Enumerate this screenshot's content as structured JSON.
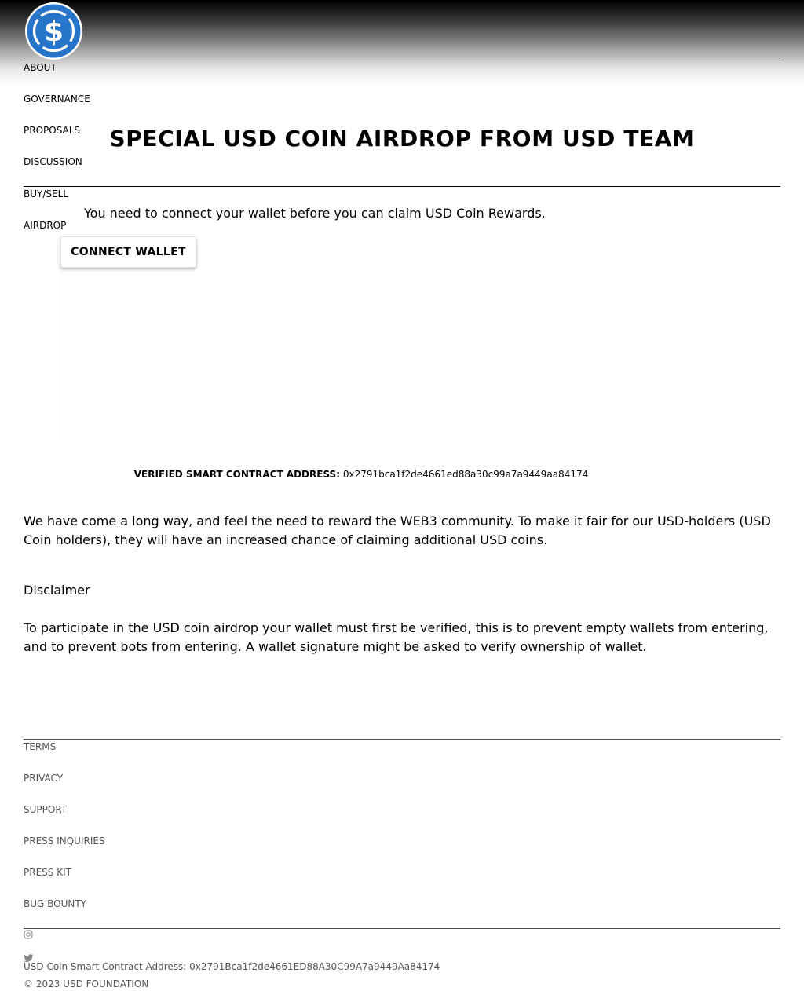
{
  "header": {
    "logo_icon": "usd-coin-logo",
    "brand_color": "#2775ca"
  },
  "nav": {
    "items": [
      {
        "label": "ABOUT"
      },
      {
        "label": "GOVERNANCE"
      },
      {
        "label": "PROPOSALS"
      },
      {
        "label": "DISCUSSION"
      },
      {
        "label": "BUY/SELL"
      },
      {
        "label": "AIRDROP"
      }
    ]
  },
  "main": {
    "title": "SPECIAL USD COIN AIRDROP FROM USD TEAM",
    "connect_message": "You need to connect your wallet before you can claim USD Coin Rewards.",
    "connect_button": "CONNECT WALLET",
    "contract_label": "VERIFIED SMART CONTRACT ADDRESS:",
    "contract_address": "0x2791bca1f2de4661ed88a30c99a7a9449aa84174",
    "intro": "We have come a long way, and feel the need to reward the WEB3 community. To make it fair for our USD-holders (USD Coin holders), they will have an increased chance of claiming additional USD coins.",
    "disclaimer_heading": "Disclaimer",
    "disclaimer_text": "To participate in the USD coin airdrop your wallet must first be verified, this is to prevent empty wallets from entering, and to prevent bots from entering. A wallet signature might be asked to verify ownership of wallet."
  },
  "footer": {
    "links": [
      {
        "label": "TERMS"
      },
      {
        "label": "PRIVACY"
      },
      {
        "label": "SUPPORT"
      },
      {
        "label": "PRESS INQUIRIES"
      },
      {
        "label": "PRESS KIT"
      },
      {
        "label": "BUG BOUNTY"
      }
    ],
    "social_icons": [
      "instagram-icon",
      "twitter-icon"
    ],
    "contract_text": "USD Coin Smart Contract Address: 0x2791Bca1f2de4661ED88A30C99A7a9449Aa84174",
    "copyright": "© 2023 USD FOUNDATION"
  }
}
